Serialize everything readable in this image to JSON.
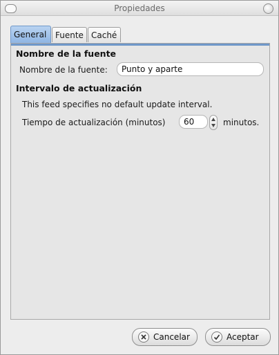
{
  "window": {
    "title": "Propiedades"
  },
  "tabs": [
    {
      "label": "General"
    },
    {
      "label": "Fuente"
    },
    {
      "label": "Caché"
    }
  ],
  "general": {
    "section1_title": "Nombre de la fuente",
    "feed_name_label": "Nombre de la fuente:",
    "feed_name_value": "Punto y aparte",
    "section2_title": "Intervalo de actualización",
    "no_interval_text": "This feed specifies no default update interval.",
    "update_time_label": "Tiempo de actualización (minutos)",
    "update_time_value": "60",
    "minutes_suffix": "minutos."
  },
  "buttons": {
    "cancel_label": "Cancelar",
    "accept_label": "Aceptar"
  },
  "icons": {
    "cancel": "cancel-circle-x-icon",
    "accept": "check-circle-icon"
  },
  "colors": {
    "active_tab": "#8db4e3",
    "panel_accent": "#6f97c9"
  }
}
